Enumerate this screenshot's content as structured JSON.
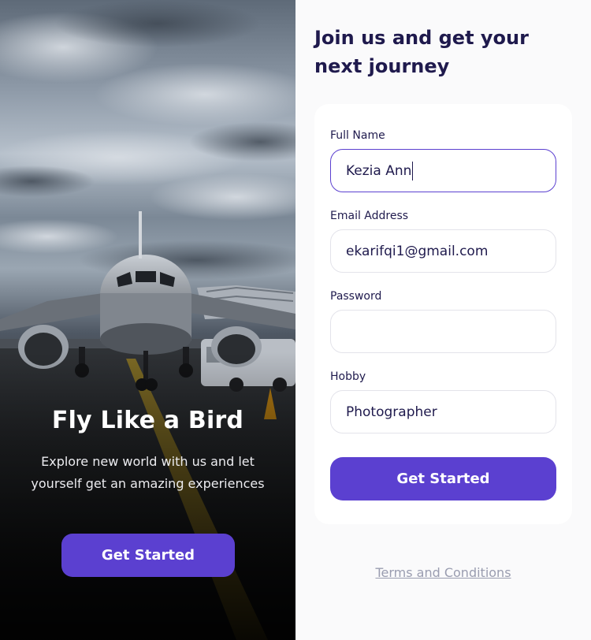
{
  "hero": {
    "title": "Fly Like a Bird",
    "subtitle": "Explore new world with us and let yourself get an amazing experiences",
    "button_label": "Get Started"
  },
  "form": {
    "headline": "Join us and get your next journey",
    "fields": [
      {
        "label": "Full Name",
        "value": "Kezia Ann",
        "focused": true
      },
      {
        "label": "Email Address",
        "value": "ekarifqi1@gmail.com"
      },
      {
        "label": "Password",
        "value": ""
      },
      {
        "label": "Hobby",
        "value": "Photographer"
      }
    ],
    "submit_label": "Get Started",
    "terms_link": "Terms and Conditions"
  },
  "colors": {
    "accent": "#5b40d0",
    "heading": "#1f1a4d",
    "muted": "#9a9db0",
    "background": "#fafafb"
  },
  "images": {
    "hero_photo": "airplane-on-runway-photo"
  }
}
